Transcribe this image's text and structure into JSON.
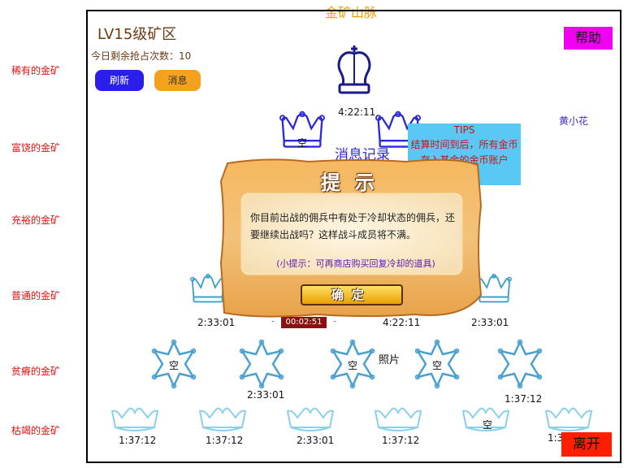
{
  "page_title": "金矿山脉",
  "side_labels": [
    "稀有的金矿",
    "富饶的金矿",
    "充裕的金矿",
    "普通的金矿",
    "贫瘠的金矿",
    "枯竭的金矿"
  ],
  "zone": {
    "title": "LV15级矿区",
    "remaining": "今日剩余抢占次数：10"
  },
  "buttons": {
    "refresh": "刷新",
    "messages": "消息",
    "help": "帮助",
    "leave": "离开"
  },
  "player_name": "黄小花",
  "empty_label": "空",
  "timers": {
    "king": "4:22:11",
    "row4": [
      "2:33:01",
      "4:22:11",
      "2:33:01"
    ],
    "row4_countdown": "00:02:51",
    "row5": [
      "2:33:01",
      "1:37:12"
    ],
    "row6": [
      "1:37:12",
      "1:37:12",
      "2:33:01",
      "1:37:12",
      "1:3"
    ]
  },
  "photo_label": "照片",
  "message_record": "消息记录",
  "tips": {
    "title": "TIPS",
    "line1": "结算时间到后，所有金币",
    "line2": "存入基金的金币账户"
  },
  "dialog": {
    "title": "提示",
    "body": "你目前出战的佣兵中有处于冷却状态的佣兵，还要继续出战吗？这样战斗成员将不满。",
    "hint": "(小提示：可再商店购买回复冷却的道具)",
    "ok": "确定"
  },
  "colors": {
    "rare_crown": "#1a1a8a",
    "rich_crown": "#2a2ad8",
    "common_crown": "#3aa0c8",
    "star": "#4aa0d0",
    "dry_crown": "#8ad0e8",
    "side_label": "#e01010"
  }
}
